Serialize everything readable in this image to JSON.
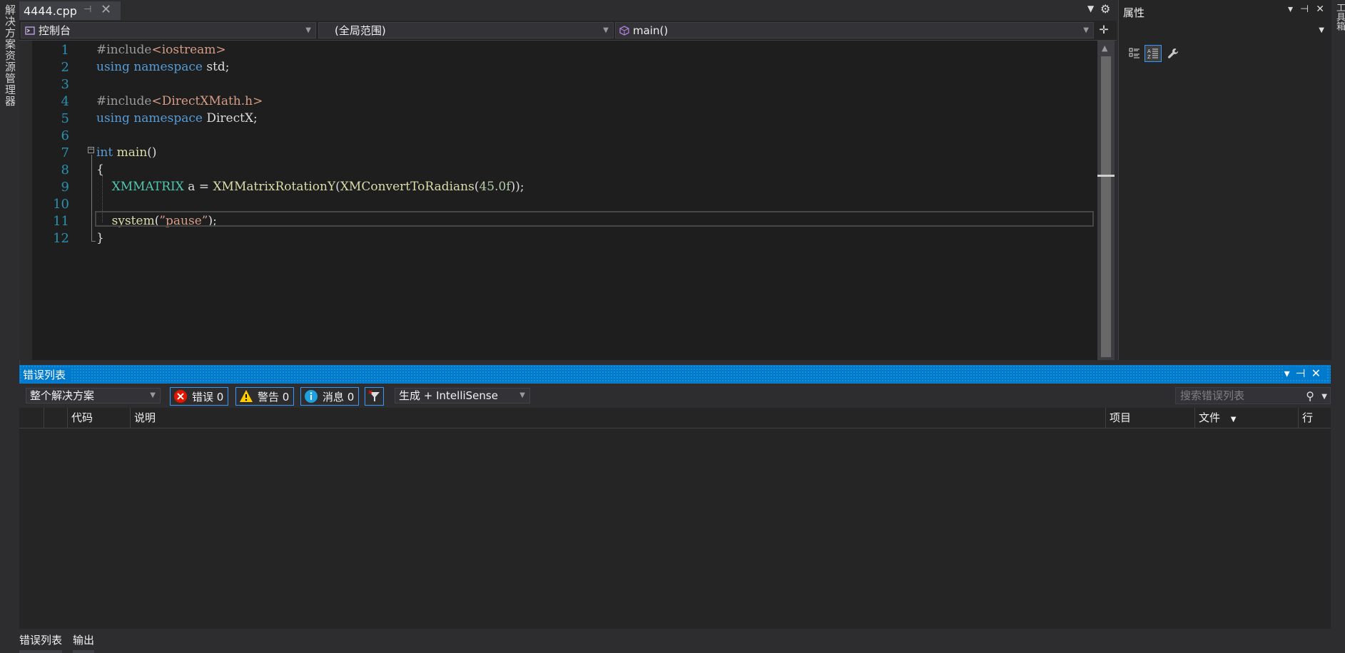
{
  "left_strip": {
    "label": "解决方案资源管理器"
  },
  "right_strip": {
    "label": "工具箱"
  },
  "editor_tab": {
    "filename": "4444.cpp",
    "pin": "⊣",
    "close": "✕"
  },
  "nav": {
    "project": "控制台",
    "scope": "(全局范围)",
    "member": "main()"
  },
  "editor": {
    "line_numbers": [
      "1",
      "2",
      "3",
      "4",
      "5",
      "6",
      "7",
      "8",
      "9",
      "10",
      "11",
      "12"
    ],
    "lines": [
      [
        {
          "t": "#include",
          "c": "pp"
        },
        {
          "t": "<iostream>",
          "c": "str"
        }
      ],
      [
        {
          "t": "using namespace",
          "c": "kw"
        },
        {
          "t": " std;",
          "c": ""
        }
      ],
      [],
      [
        {
          "t": "#include",
          "c": "pp"
        },
        {
          "t": "<DirectXMath.h>",
          "c": "str"
        }
      ],
      [
        {
          "t": "using namespace",
          "c": "kw"
        },
        {
          "t": " DirectX;",
          "c": ""
        }
      ],
      [],
      [
        {
          "t": "int",
          "c": "kw"
        },
        {
          "t": " ",
          "c": ""
        },
        {
          "t": "main",
          "c": "fn"
        },
        {
          "t": "()",
          "c": ""
        }
      ],
      [
        {
          "t": "{",
          "c": ""
        }
      ],
      [
        {
          "t": "    ",
          "c": ""
        },
        {
          "t": "XMMATRIX",
          "c": "ty"
        },
        {
          "t": " a = ",
          "c": ""
        },
        {
          "t": "XMMatrixRotationY",
          "c": "fn"
        },
        {
          "t": "(",
          "c": ""
        },
        {
          "t": "XMConvertToRadians",
          "c": "fn"
        },
        {
          "t": "(",
          "c": ""
        },
        {
          "t": "45.0f",
          "c": "num"
        },
        {
          "t": "));",
          "c": ""
        }
      ],
      [],
      [
        {
          "t": "    ",
          "c": ""
        },
        {
          "t": "system",
          "c": "fn"
        },
        {
          "t": "(",
          "c": ""
        },
        {
          "t": "”pause”",
          "c": "str"
        },
        {
          "t": ");",
          "c": ""
        }
      ],
      [
        {
          "t": "}",
          "c": ""
        }
      ]
    ]
  },
  "properties": {
    "title": "属性"
  },
  "error_list": {
    "title": "错误列表",
    "scope_combo": "整个解决方案",
    "errors_label": "错误 0",
    "warnings_label": "警告 0",
    "messages_label": "消息 0",
    "source_combo": "生成 + IntelliSense",
    "search_placeholder": "搜索错误列表",
    "columns": {
      "code": "代码",
      "description": "说明",
      "project": "项目",
      "file": "文件",
      "line": "行"
    }
  },
  "bottom_tabs": {
    "error_list": "错误列表",
    "output": "输出"
  },
  "colors": {
    "accent": "#007acc",
    "editor_bg": "#1e1e1e",
    "keyword": "#569cd6",
    "string": "#d69d85",
    "type": "#4ec9b0",
    "line_number": "#2b91af"
  }
}
